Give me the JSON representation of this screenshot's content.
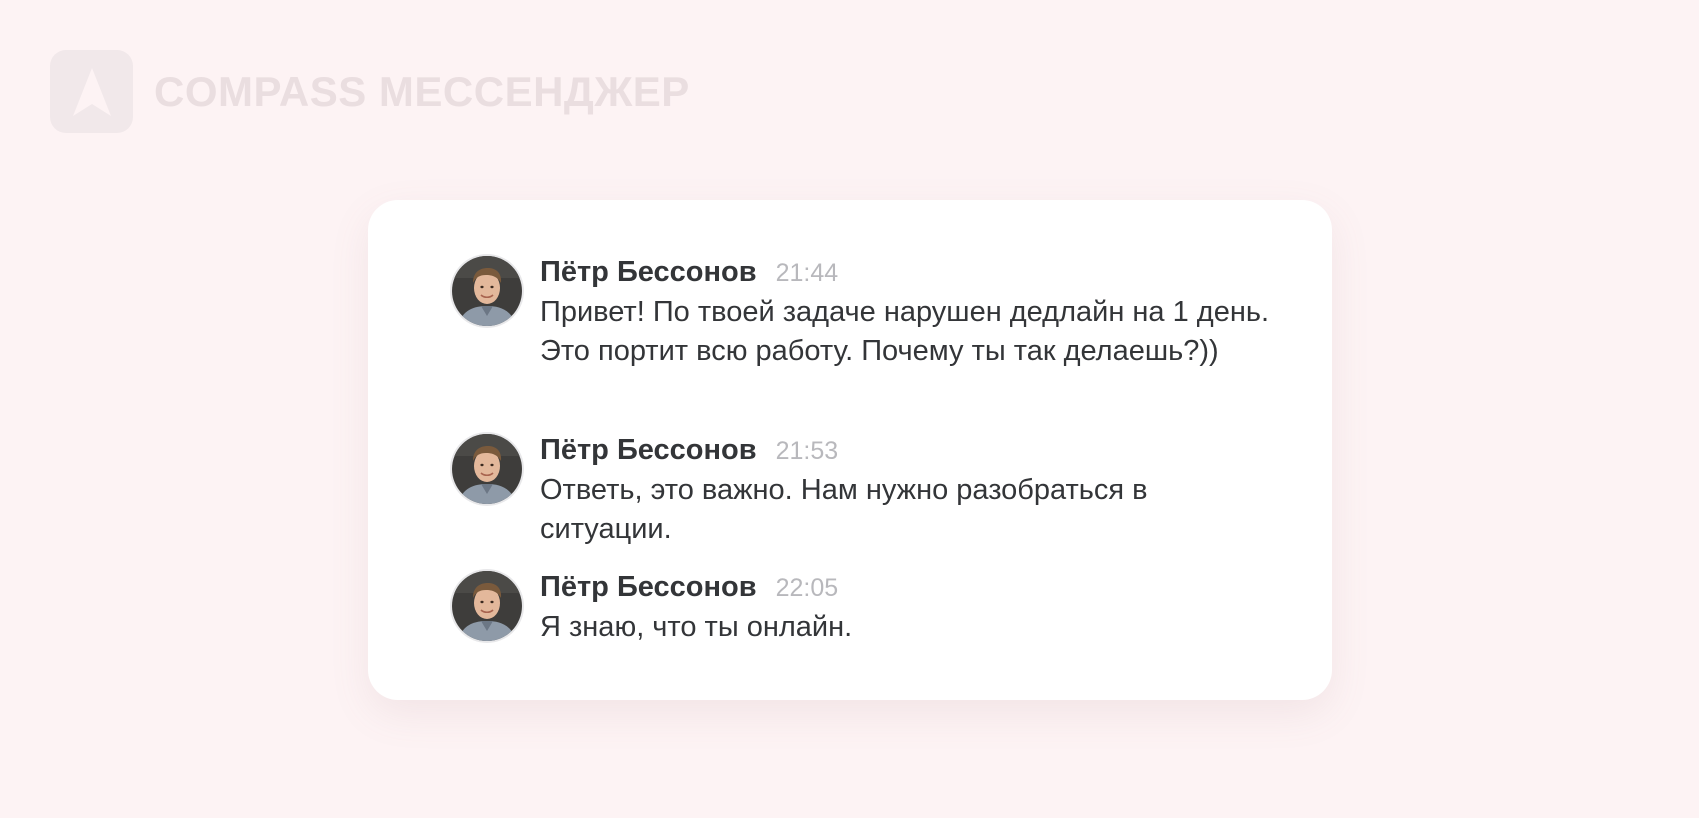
{
  "app": {
    "logo_icon": "compass-logo-icon",
    "name": "COMPASS МЕССЕНДЖЕР"
  },
  "colors": {
    "background": "#fdf3f4",
    "card": "#ffffff",
    "text": "#333538",
    "time": "#b8b8bc",
    "logo": "#eadee0"
  },
  "messages": [
    {
      "avatar_icon": "user-avatar",
      "author": "Пётр Бессонов",
      "time": "21:44",
      "text": "Привет! По твоей задаче нарушен дедлайн на 1 день. Это портит всю работу. Почему ты так делаешь?))"
    },
    {
      "avatar_icon": "user-avatar",
      "author": "Пётр Бессонов",
      "time": "21:53",
      "text": "Ответь, это важно. Нам нужно разобраться в ситуации."
    },
    {
      "avatar_icon": "user-avatar",
      "author": "Пётр Бессонов",
      "time": "22:05",
      "text": "Я знаю, что ты онлайн."
    }
  ]
}
